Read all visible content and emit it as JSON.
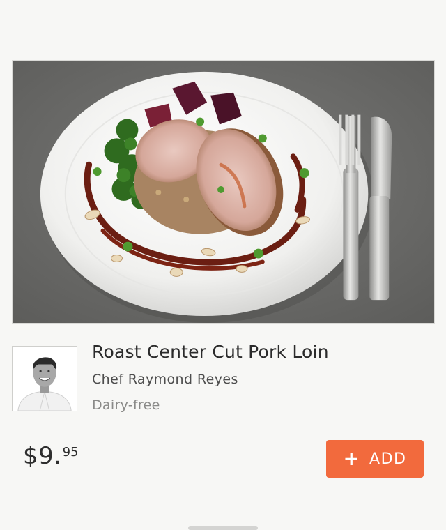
{
  "dish": {
    "name": "Roast Center Cut Pork Loin",
    "chef": "Chef Raymond Reyes",
    "diet": "Dairy-free"
  },
  "price": {
    "main": "$9.",
    "cents": "95"
  },
  "actions": {
    "add_label": "ADD",
    "add_icon": "plus-icon"
  },
  "colors": {
    "accent": "#f26a3d",
    "background": "#f7f7f5",
    "text_primary": "#2b2b2b",
    "text_muted": "#8a8a88"
  }
}
